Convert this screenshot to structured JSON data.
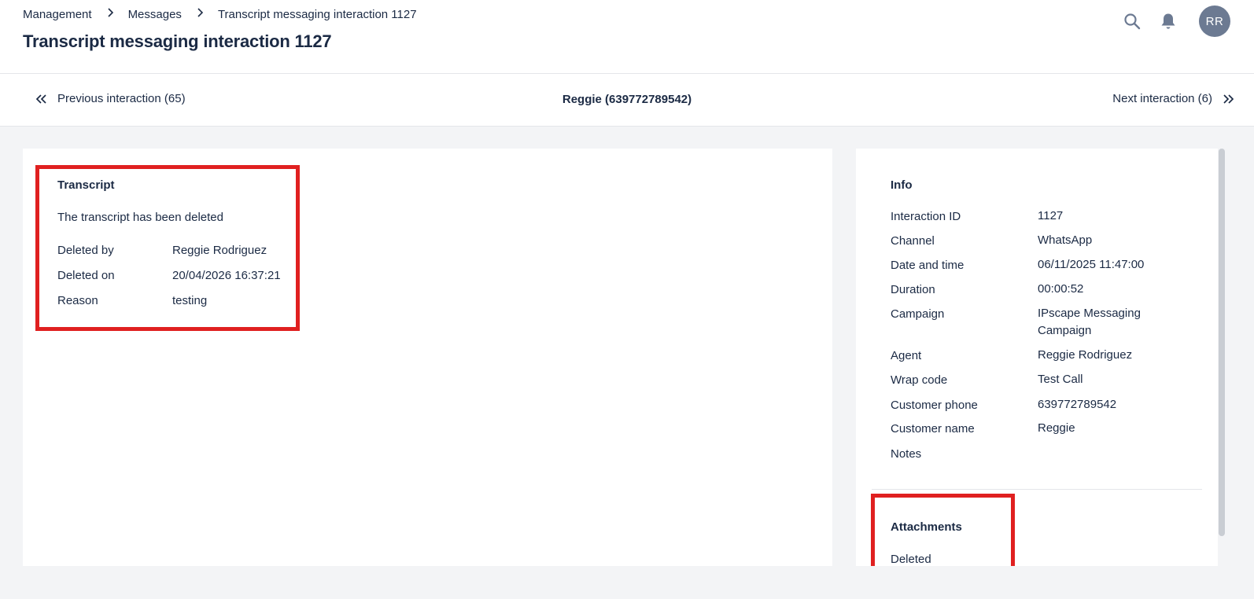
{
  "breadcrumb": {
    "items": [
      "Management",
      "Messages"
    ],
    "current": "Transcript messaging interaction 1127"
  },
  "page_title": "Transcript messaging interaction 1127",
  "user": {
    "initials": "RR"
  },
  "icons": {
    "search": "search-icon",
    "notifications": "bell-icon",
    "prev": "double-chevron-left-icon",
    "next": "double-chevron-right-icon"
  },
  "nav": {
    "previous_label": "Previous interaction (65)",
    "contact": "Reggie (639772789542)",
    "next_label": "Next interaction (6)"
  },
  "transcript": {
    "title": "Transcript",
    "message": "The transcript has been deleted",
    "fields": [
      {
        "label": "Deleted by",
        "value": "Reggie Rodriguez"
      },
      {
        "label": "Deleted on",
        "value": "20/04/2026 16:37:21"
      },
      {
        "label": "Reason",
        "value": "testing"
      }
    ]
  },
  "info": {
    "title": "Info",
    "fields": [
      {
        "label": "Interaction ID",
        "value": "1127"
      },
      {
        "label": "Channel",
        "value": "WhatsApp"
      },
      {
        "label": "Date and time",
        "value": "06/11/2025 11:47:00"
      },
      {
        "label": "Duration",
        "value": "00:00:52"
      },
      {
        "label": "Campaign",
        "value": "IPscape Messaging Campaign"
      },
      {
        "label": "Agent",
        "value": "Reggie Rodriguez"
      },
      {
        "label": "Wrap code",
        "value": "Test Call"
      },
      {
        "label": "Customer phone",
        "value": "639772789542"
      },
      {
        "label": "Customer name",
        "value": "Reggie"
      },
      {
        "label": "Notes",
        "value": ""
      }
    ]
  },
  "attachments": {
    "title": "Attachments",
    "value": "Deleted"
  },
  "colors": {
    "text": "#1b2a44",
    "highlight": "#e02020",
    "avatar_bg": "#6c7a92",
    "page_bg": "#f3f4f6"
  }
}
